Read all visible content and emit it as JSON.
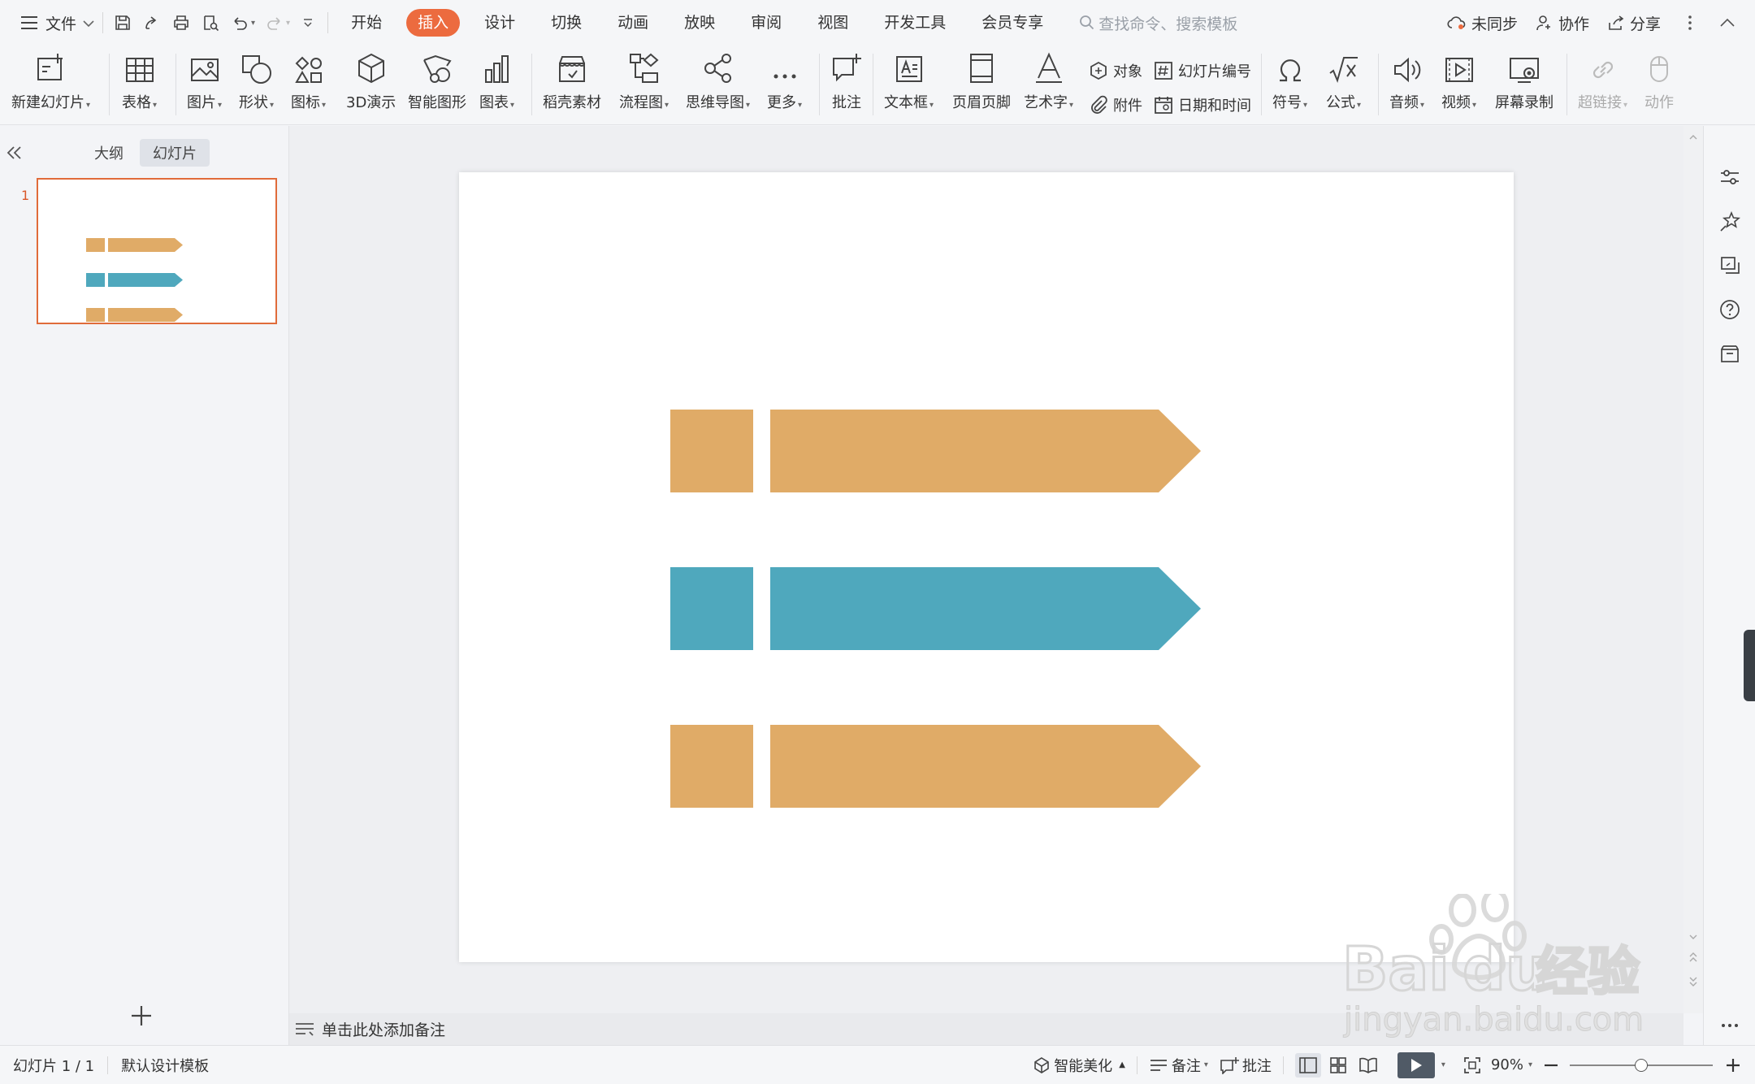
{
  "menubar": {
    "file_label": "文件",
    "tabs": [
      "开始",
      "插入",
      "设计",
      "切换",
      "动画",
      "放映",
      "审阅",
      "视图",
      "开发工具",
      "会员专享"
    ],
    "active_tab": "插入",
    "search_placeholder": "查找命令、搜索模板",
    "right_actions": {
      "sync": "未同步",
      "collab": "协作",
      "share": "分享"
    }
  },
  "ribbon": {
    "new_slide": "新建幻灯片",
    "table": "表格",
    "picture": "图片",
    "shape": "形状",
    "icon": "图标",
    "threed": "3D演示",
    "smartart": "智能图形",
    "chart": "图表",
    "docer": "稻壳素材",
    "flowchart": "流程图",
    "mindmap": "思维导图",
    "more": "更多",
    "comment": "批注",
    "textbox": "文本框",
    "header_footer": "页眉页脚",
    "wordart": "艺术字",
    "object": "对象",
    "attachment": "附件",
    "slide_number": "幻灯片编号",
    "datetime": "日期和时间",
    "symbol": "符号",
    "formula": "公式",
    "audio": "音频",
    "video": "视频",
    "screen_record": "屏幕录制",
    "hyperlink": "超链接",
    "action": "动作"
  },
  "left_panel": {
    "tab_outline": "大纲",
    "tab_slides": "幻灯片",
    "slide_number": "1"
  },
  "slide": {
    "shape_colors": [
      "#e0ab67",
      "#4fa8bd",
      "#e0ab67"
    ]
  },
  "notes": {
    "placeholder": "单击此处添加备注"
  },
  "statusbar": {
    "slide_info": "幻灯片 1 / 1",
    "template": "默认设计模板",
    "beautify": "智能美化",
    "notes": "备注",
    "comment": "批注",
    "zoom": "90%"
  },
  "watermark": {
    "brand": "Bai",
    "brand2": "du",
    "cn": "经验",
    "url": "jingyan.baidu.com"
  }
}
